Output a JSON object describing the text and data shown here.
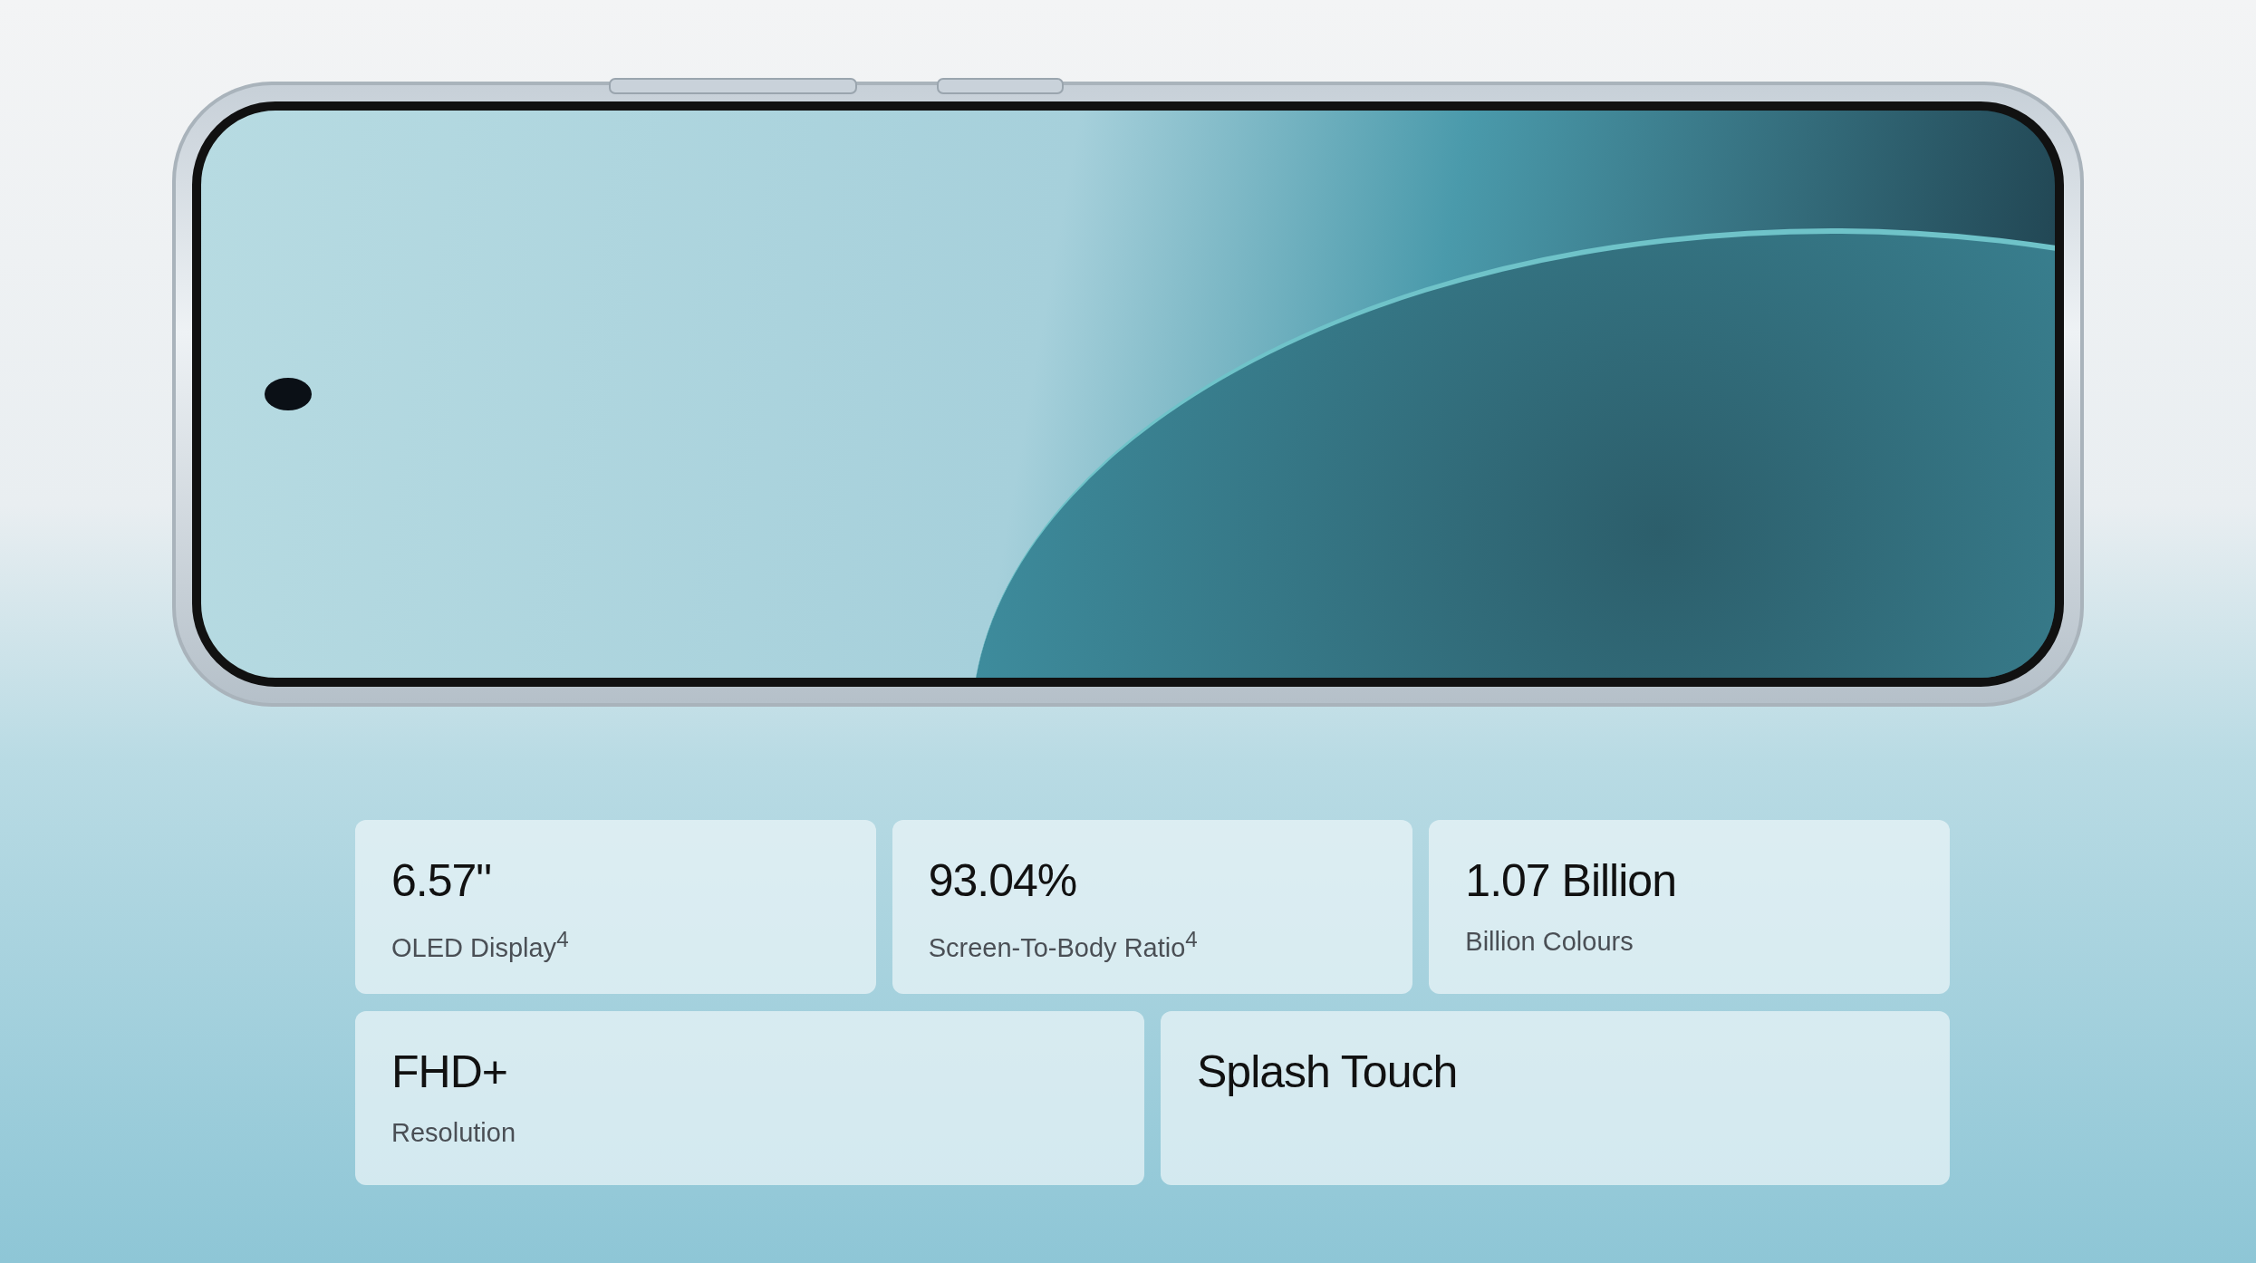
{
  "spec_rows": [
    [
      {
        "value": "6.57\"",
        "label": "OLED Display$^{4}$"
      },
      {
        "value": "93.04%",
        "label": "Screen-To-Body Ratio$^{4}$"
      },
      {
        "value": "1.07 Billion",
        "label": "Billion Colours"
      }
    ],
    [
      {
        "value": "FHD+",
        "label": "Resolution"
      },
      {
        "value": "Splash Touch"
      }
    ]
  ]
}
